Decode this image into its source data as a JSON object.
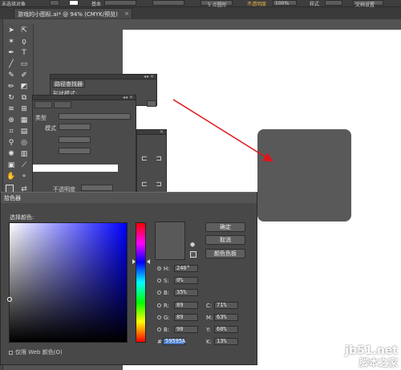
{
  "options_bar": {
    "label_opacity": "未选择对象",
    "label_style": "基本",
    "points_value": "5 点圆形",
    "label_opacity2": "不透明度",
    "opacity_value": "100%",
    "label_styles": "样式",
    "doc_setup": "文档设置"
  },
  "document_tab": {
    "title": "游戏的小图标.ai* @ 94% (CMYK/预览)",
    "close": "×"
  },
  "pathfinder_panel": {
    "tab_label": "路径查找器",
    "shape_modes_label": "形状模式:"
  },
  "panels": {
    "type_label": "类型",
    "options_label": "模式",
    "opacity_label": "不透明度"
  },
  "color_picker": {
    "title": "拾色器",
    "select_label": "选择颜色:",
    "ok_label": "确定",
    "cancel_label": "取消",
    "swatches_label": "颜色色板",
    "fields": {
      "H": {
        "label": "H:",
        "value": "240°"
      },
      "S": {
        "label": "S:",
        "value": "0%"
      },
      "B": {
        "label": "B:",
        "value": "35%"
      },
      "R": {
        "label": "R:",
        "value": "89"
      },
      "G": {
        "label": "G:",
        "value": "89"
      },
      "Bv": {
        "label": "B:",
        "value": "90"
      },
      "C": {
        "label": "C:",
        "value": "71%"
      },
      "M": {
        "label": "M:",
        "value": "63%"
      },
      "Y": {
        "label": "Y:",
        "value": "60%"
      },
      "K": {
        "label": "K:",
        "value": "13%"
      },
      "hex_label": "#",
      "hex": "59595A"
    },
    "web_only_label": "仅限 Web 颜色(O)",
    "selected_color": "#59595A"
  },
  "canvas": {
    "shape_color": "#595959",
    "arrow_color": "#e0151b"
  },
  "watermark": {
    "line1": "jb51.net",
    "line2": "脚本之家"
  }
}
